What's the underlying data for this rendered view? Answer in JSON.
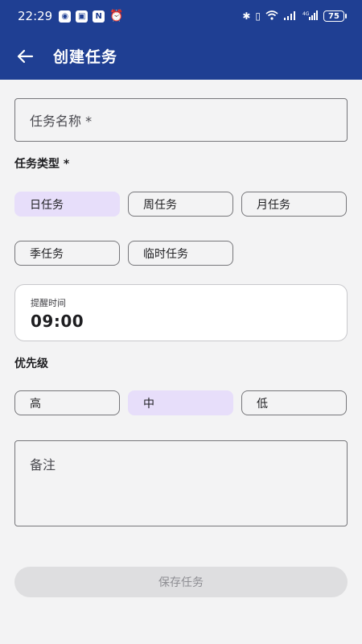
{
  "status_bar": {
    "time": "22:29",
    "battery": "75",
    "left_icons": [
      "camera-icon",
      "gallery-icon",
      "nfc-icon",
      "alarm-icon"
    ],
    "right_icons": [
      "bluetooth-icon",
      "vibrate-icon",
      "wifi-icon",
      "signal-icon",
      "signal-4g-icon"
    ]
  },
  "app_bar": {
    "title": "创建任务",
    "background": "#1f3f93"
  },
  "form": {
    "name_placeholder": "任务名称 *",
    "type_label": "任务类型 *",
    "type_options": [
      "日任务",
      "周任务",
      "月任务",
      "季任务",
      "临时任务"
    ],
    "type_selected": "日任务",
    "reminder_label": "提醒时间",
    "reminder_value": "09:00",
    "priority_label": "优先级",
    "priority_options": [
      "高",
      "中",
      "低"
    ],
    "priority_selected": "中",
    "notes_placeholder": "备注",
    "save_label": "保存任务"
  },
  "colors": {
    "accent": "#1f3f93",
    "chip_selected": "#e7defa",
    "button_disabled": "#dedee0"
  }
}
